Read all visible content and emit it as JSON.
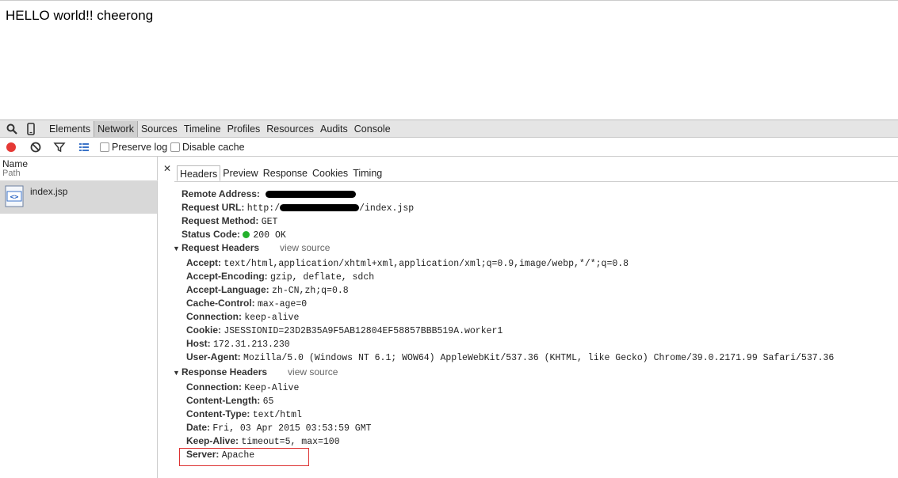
{
  "page": {
    "text": "HELLO world!! cheerong"
  },
  "devtools": {
    "tabs": [
      "Elements",
      "Network",
      "Sources",
      "Timeline",
      "Profiles",
      "Resources",
      "Audits",
      "Console"
    ],
    "active_tab": "Network",
    "preserve_log_label": "Preserve log",
    "disable_cache_label": "Disable cache",
    "columns": {
      "name": "Name",
      "path": "Path"
    },
    "request_file": "index.jsp",
    "detail_tabs": [
      "Headers",
      "Preview",
      "Response",
      "Cookies",
      "Timing"
    ],
    "active_detail_tab": "Headers",
    "general": {
      "remote_address_key": "Remote Address:",
      "request_url_key": "Request URL:",
      "request_url_prefix": "http:/",
      "request_url_suffix": "/index.jsp",
      "request_method_key": "Request Method:",
      "request_method_val": "GET",
      "status_code_key": "Status Code:",
      "status_code_val": "200 OK"
    },
    "view_source_label": "view source",
    "request_headers_title": "Request Headers",
    "request_headers": [
      {
        "key": "Accept:",
        "value": "text/html,application/xhtml+xml,application/xml;q=0.9,image/webp,*/*;q=0.8"
      },
      {
        "key": "Accept-Encoding:",
        "value": "gzip, deflate, sdch"
      },
      {
        "key": "Accept-Language:",
        "value": "zh-CN,zh;q=0.8"
      },
      {
        "key": "Cache-Control:",
        "value": "max-age=0"
      },
      {
        "key": "Connection:",
        "value": "keep-alive"
      },
      {
        "key": "Cookie:",
        "value": "JSESSIONID=23D2B35A9F5AB12804EF58857BBB519A.worker1"
      },
      {
        "key": "Host:",
        "value": "172.31.213.230"
      },
      {
        "key": "User-Agent:",
        "value": "Mozilla/5.0 (Windows NT 6.1; WOW64) AppleWebKit/537.36 (KHTML, like Gecko) Chrome/39.0.2171.99 Safari/537.36"
      }
    ],
    "response_headers_title": "Response Headers",
    "response_headers": [
      {
        "key": "Connection:",
        "value": "Keep-Alive"
      },
      {
        "key": "Content-Length:",
        "value": "65"
      },
      {
        "key": "Content-Type:",
        "value": "text/html"
      },
      {
        "key": "Date:",
        "value": "Fri, 03 Apr 2015 03:53:59 GMT"
      },
      {
        "key": "Keep-Alive:",
        "value": "timeout=5, max=100"
      },
      {
        "key": "Server:",
        "value": "Apache"
      }
    ],
    "colors": {
      "record": "#e53935",
      "status_ok": "#24b12c",
      "highlight": "#dd3333"
    }
  }
}
